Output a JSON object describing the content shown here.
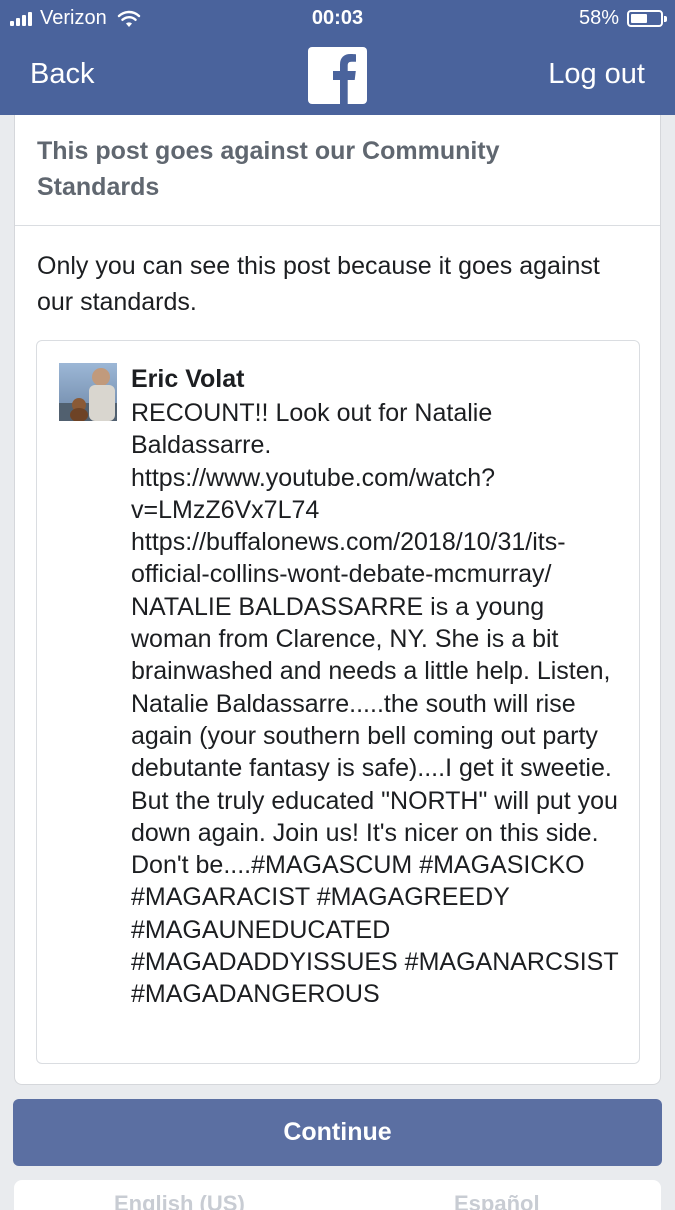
{
  "status_bar": {
    "carrier": "Verizon",
    "time": "00:03",
    "battery": "58%",
    "battery_level": 0.58
  },
  "nav": {
    "back_label": "Back",
    "logout_label": "Log out",
    "logo_icon": "facebook-logo-icon"
  },
  "card": {
    "title": "This post goes against our Community Standards",
    "notice": "Only you can see this post because it goes against our standards."
  },
  "post": {
    "author": "Eric Volat",
    "text": "RECOUNT!! Look out for Natalie Baldassarre.\nhttps://www.youtube.com/watch?\nv=LMzZ6Vx7L74\nhttps://buffalonews.com/2018/10/31/its-\nofficial-collins-wont-debate-mcmurray/\nNATALIE BALDASSARRE is a young woman from Clarence, NY. She is a bit brainwashed and needs a little help. Listen, Natalie Baldassarre.....the south will rise again (your southern bell coming out party debutante fantasy is safe)....I get it sweetie. But the truly educated \"NORTH\" will put you down again. Join us! It's nicer on this side. Don't be....#MAGASCUM #MAGASICKO #MAGARACIST #MAGAGREEDY #MAGAUNEDUCATED #MAGADADDYISSUES #MAGANARCSIST #MAGADANGEROUS"
  },
  "actions": {
    "continue_label": "Continue"
  },
  "footer": {
    "lang_left": "English (US)",
    "lang_right": "Español"
  },
  "colors": {
    "brand": "#4a639c",
    "button": "#5b6fa2",
    "background": "#e9ebee"
  }
}
